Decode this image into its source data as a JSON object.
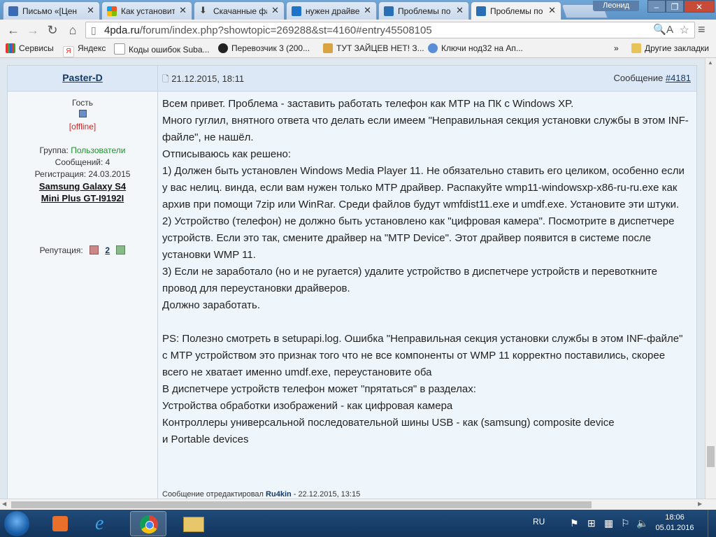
{
  "browser": {
    "tabs": [
      {
        "label": "Письмо «[Цен",
        "icon": "mail-icon",
        "color": "#3b6bb4"
      },
      {
        "label": "Как установит",
        "icon": "windows-icon",
        "color": "#e33"
      },
      {
        "label": "Скачанные фа",
        "icon": "download-icon",
        "color": "#444"
      },
      {
        "label": "нужен драйве",
        "icon": "search-icon",
        "color": "#1e73c8"
      },
      {
        "label": "Проблемы по",
        "icon": "4pda-icon",
        "color": "#2a6fb6"
      },
      {
        "label": "Проблемы по",
        "icon": "4pda-icon",
        "color": "#2a6fb6"
      }
    ],
    "user_name": "Леонид",
    "url_host": "4pda.ru",
    "url_path": "/forum/index.php?showtopic=269288&st=4160#entry45508105",
    "bookmarks": [
      {
        "label": "Сервисы",
        "icon": "apps-icon"
      },
      {
        "label": "Яндекс",
        "icon": "yandex-icon"
      },
      {
        "label": "Коды ошибок Suba...",
        "icon": "page-icon"
      },
      {
        "label": "Перевозчик 3 (200...",
        "icon": "avatar-icon"
      },
      {
        "label": "ТУТ ЗАЙЦЕВ НЕТ! З...",
        "icon": "pencil-icon"
      },
      {
        "label": "Ключи нод32 на Ап...",
        "icon": "eset-icon"
      }
    ],
    "bookmarks_overflow": "»",
    "other_bookmarks": "Другие закладки"
  },
  "post": {
    "author": "Paster-D",
    "date": "21.12.2015, 18:11",
    "number_label": "Сообщение",
    "number": "#4181",
    "author_status": "Гость",
    "author_online": "[offline]",
    "group_label": "Группа:",
    "group_value": "Пользователи",
    "posts_label": "Сообщений: 4",
    "registration": "Регистрация: 24.03.2015",
    "device": "Samsung Galaxy S4 Mini Plus GT-I9192I",
    "reputation_label": "Репутация:",
    "reputation_value": "2",
    "lines": [
      "Всем привет. Проблема - заставить работать телефон как MTP на ПК с Windows XP.",
      "Много гуглил, внятного ответа что делать если имеем \"Неправильная секция установки службы в этом INF-файле\", не нашёл.",
      "Отписываюсь как решено:",
      "1) Должен быть установлен Windows Media Player 11. Не обязательно ставить его целиком, особенно если у вас нелиц. винда, если вам нужен только MTP драйвер. Распакуйте wmp11-windowsxp-x86-ru-ru.exe как архив при помощи 7zip или WinRar. Среди файлов будут wmfdist11.exe и umdf.exe. Установите эти штуки.",
      "2) Устройство (телефон) не должно быть установлено как \"цифровая камера\". Посмотрите в диспетчере устройств. Если это так, смените драйвер на \"MTP Device\". Этот драйвер появится в системе после установки WMP 11.",
      "3) Если не заработало (но и не ругается) удалите устройство в диспетчере устройств и перевоткните провод для переустановки драйверов.",
      "Должно заработать.",
      "",
      "PS: Полезно смотреть в setupapi.log. Ошибка \"Неправильная секция установки службы в этом INF-файле\" с MTP устройством это признак того что не все компоненты от WMP 11 корректно поставились, скорее всего не хватает именно umdf.exe, переустановите оба",
      "В диспетчере устройств телефон может \"прятаться\" в разделах:",
      "Устройства обработки изображений - как цифровая камера",
      "Контроллеры универсальной последовательной шины USB - как (samsung) composite device",
      "и Portable devices"
    ],
    "edited_prefix": "Сообщение отредактировал",
    "edited_by": "Ru4kin",
    "edited_when": "- 22.12.2015, 13:15"
  },
  "taskbar": {
    "language": "RU",
    "time": "18:06",
    "date": "05.01.2016"
  }
}
